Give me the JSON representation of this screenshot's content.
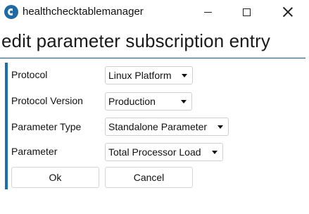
{
  "window": {
    "title": "healthchecktablemanager",
    "icon": "app-logo-icon",
    "controls": [
      "minimize-icon",
      "maximize-icon",
      "close-icon"
    ]
  },
  "dialog": {
    "heading": "edit parameter subscription entry",
    "accent_color": "#1a6fb0"
  },
  "form": {
    "protocol": {
      "label": "Protocol",
      "value": "Linux Platform"
    },
    "protocol_version": {
      "label": "Protocol Version",
      "value": "Production"
    },
    "parameter_type": {
      "label": "Parameter Type",
      "value": "Standalone Parameter"
    },
    "parameter": {
      "label": "Parameter",
      "value": "Total Processor Load"
    }
  },
  "buttons": {
    "ok": "Ok",
    "cancel": "Cancel"
  }
}
